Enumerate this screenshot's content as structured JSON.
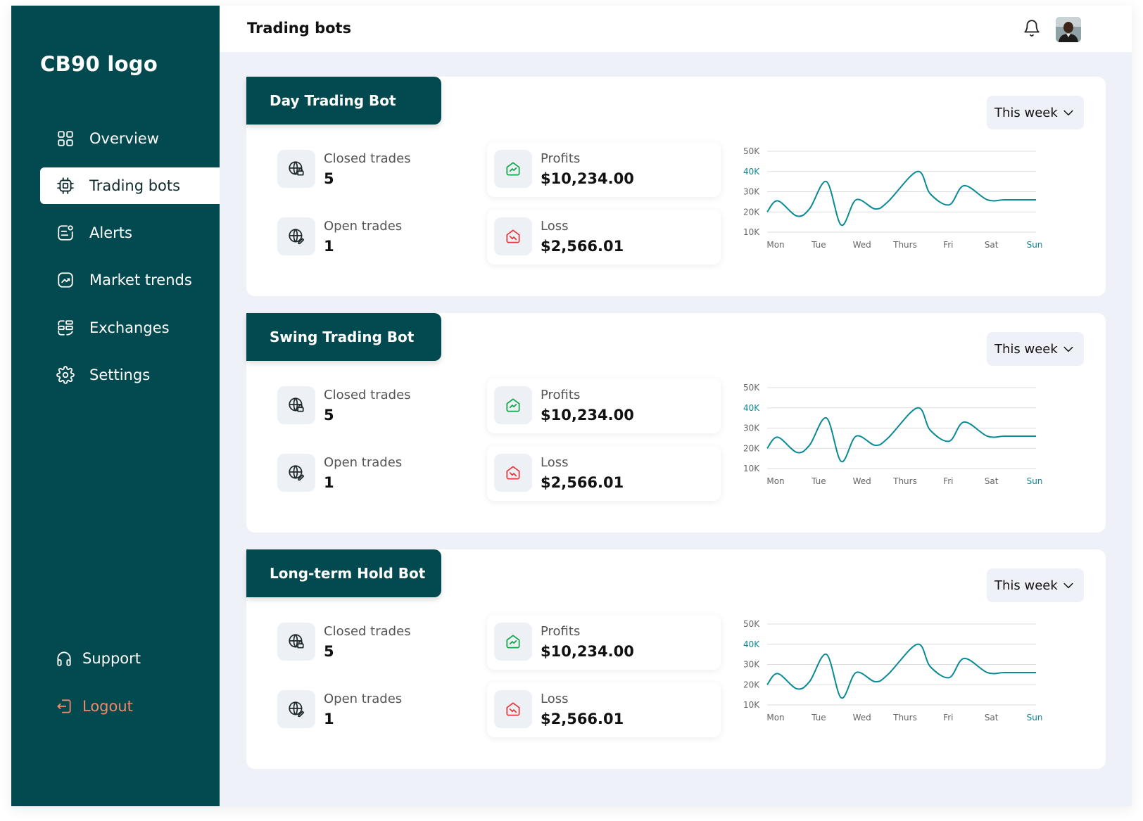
{
  "app": {
    "logo": "CB90 logo",
    "colors": {
      "sidebar": "#024a4f",
      "accent": "#0b8a96",
      "profit": "#16a34a",
      "loss": "#e03b3b",
      "logout": "#f0896a"
    }
  },
  "sidebar": {
    "items": [
      {
        "label": "Overview",
        "icon": "grid-icon",
        "active": false
      },
      {
        "label": "Trading bots",
        "icon": "chip-icon",
        "active": true
      },
      {
        "label": "Alerts",
        "icon": "alert-icon",
        "active": false
      },
      {
        "label": "Market trends",
        "icon": "trend-icon",
        "active": false
      },
      {
        "label": "Exchanges",
        "icon": "exchange-icon",
        "active": false
      },
      {
        "label": "Settings",
        "icon": "gear-icon",
        "active": false
      }
    ],
    "support_label": "Support",
    "logout_label": "Logout"
  },
  "header": {
    "title": "Trading bots",
    "notification_icon": "bell-icon",
    "avatar": "user-avatar"
  },
  "bots": [
    {
      "name": "Day Trading Bot",
      "period": "This week",
      "closed_label": "Closed trades",
      "closed_value": "5",
      "open_label": "Open trades",
      "open_value": "1",
      "profit_label": "Profits",
      "profit_value": "$10,234.00",
      "loss_label": "Loss",
      "loss_value": "$2,566.01"
    },
    {
      "name": "Swing Trading Bot",
      "period": "This week",
      "closed_label": "Closed trades",
      "closed_value": "5",
      "open_label": "Open trades",
      "open_value": "1",
      "profit_label": "Profits",
      "profit_value": "$10,234.00",
      "loss_label": "Loss",
      "loss_value": "$2,566.01"
    },
    {
      "name": "Long-term Hold Bot",
      "period": "This week",
      "closed_label": "Closed trades",
      "closed_value": "5",
      "open_label": "Open trades",
      "open_value": "1",
      "profit_label": "Profits",
      "profit_value": "$10,234.00",
      "loss_label": "Loss",
      "loss_value": "$2,566.01"
    }
  ],
  "chart_data": [
    {
      "type": "line",
      "categories": [
        "Mon",
        "Tue",
        "Wed",
        "Thurs",
        "Fri",
        "Sat",
        "Sun"
      ],
      "highlight_category": "Sun",
      "y_ticks": [
        "10K",
        "20K",
        "30K",
        "40K",
        "50K"
      ],
      "highlight_tick": "40K",
      "ylim": [
        10000,
        50000
      ],
      "grid": true,
      "line_color": "#0b8a96",
      "x": [
        0,
        0.25,
        0.7,
        1.0,
        1.4,
        1.75,
        2.1,
        2.55,
        2.85,
        3.55,
        3.85,
        4.3,
        4.65,
        5.2,
        5.6,
        6.0,
        6.35
      ],
      "y": [
        20000,
        25500,
        18000,
        21500,
        35000,
        13500,
        26000,
        21500,
        25000,
        40000,
        29000,
        23500,
        33000,
        26000,
        26000,
        26000,
        26000
      ]
    },
    {
      "type": "line",
      "categories": [
        "Mon",
        "Tue",
        "Wed",
        "Thurs",
        "Fri",
        "Sat",
        "Sun"
      ],
      "highlight_category": "Sun",
      "y_ticks": [
        "10K",
        "20K",
        "30K",
        "40K",
        "50K"
      ],
      "highlight_tick": "40K",
      "ylim": [
        10000,
        50000
      ],
      "grid": true,
      "line_color": "#0b8a96",
      "x": [
        0,
        0.25,
        0.7,
        1.0,
        1.4,
        1.75,
        2.1,
        2.55,
        2.85,
        3.55,
        3.85,
        4.3,
        4.65,
        5.2,
        5.6,
        6.0,
        6.35
      ],
      "y": [
        20000,
        25500,
        18000,
        21500,
        35000,
        13500,
        26000,
        21500,
        25000,
        40000,
        29000,
        23500,
        33000,
        26000,
        26000,
        26000,
        26000
      ]
    },
    {
      "type": "line",
      "categories": [
        "Mon",
        "Tue",
        "Wed",
        "Thurs",
        "Fri",
        "Sat",
        "Sun"
      ],
      "highlight_category": "Sun",
      "y_ticks": [
        "10K",
        "20K",
        "30K",
        "40K",
        "50K"
      ],
      "highlight_tick": "40K",
      "ylim": [
        10000,
        50000
      ],
      "grid": true,
      "line_color": "#0b8a96",
      "x": [
        0,
        0.25,
        0.7,
        1.0,
        1.4,
        1.75,
        2.1,
        2.55,
        2.85,
        3.55,
        3.85,
        4.3,
        4.65,
        5.2,
        5.6,
        6.0,
        6.35
      ],
      "y": [
        20000,
        25500,
        18000,
        21500,
        35000,
        13500,
        26000,
        21500,
        25000,
        40000,
        29000,
        23500,
        33000,
        26000,
        26000,
        26000,
        26000
      ]
    }
  ]
}
